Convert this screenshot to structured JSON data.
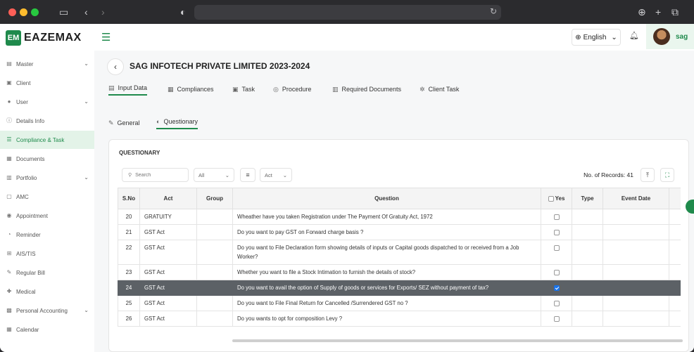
{
  "brand": {
    "name": "EAZEMAX",
    "mark": "EM",
    "accent": "#1f8a4c"
  },
  "header": {
    "language": "English",
    "user": "sag"
  },
  "sidebar": {
    "items": [
      {
        "label": "Master",
        "icon": "database-icon",
        "expandable": true
      },
      {
        "label": "Client",
        "icon": "client-icon",
        "expandable": false
      },
      {
        "label": "User",
        "icon": "user-icon",
        "expandable": true
      },
      {
        "label": "Details Info",
        "icon": "info-icon",
        "expandable": false
      },
      {
        "label": "Compliance & Task",
        "icon": "checklist-icon",
        "expandable": false,
        "active": true
      },
      {
        "label": "Documents",
        "icon": "documents-icon",
        "expandable": false
      },
      {
        "label": "Portfolio",
        "icon": "portfolio-icon",
        "expandable": true
      },
      {
        "label": "AMC",
        "icon": "amc-icon",
        "expandable": false
      },
      {
        "label": "Appointment",
        "icon": "appointment-icon",
        "expandable": false
      },
      {
        "label": "Reminder",
        "icon": "reminder-icon",
        "expandable": false
      },
      {
        "label": "AIS/TIS",
        "icon": "ais-icon",
        "expandable": false
      },
      {
        "label": "Regular Bill",
        "icon": "bill-icon",
        "expandable": false
      },
      {
        "label": "Medical",
        "icon": "medical-icon",
        "expandable": false
      },
      {
        "label": "Personal Accounting",
        "icon": "accounting-icon",
        "expandable": true
      },
      {
        "label": "Calendar",
        "icon": "calendar-icon",
        "expandable": false
      }
    ]
  },
  "page": {
    "title": "SAG INFOTECH PRIVATE LIMITED 2023-2024",
    "tabs": [
      "Input Data",
      "Compliances",
      "Task",
      "Procedure",
      "Required Documents",
      "Client Task"
    ],
    "subtabs": [
      "General",
      "Questionary"
    ]
  },
  "questionary": {
    "title": "QUESTIONARY",
    "search_placeholder": "Search",
    "filter_all": "All",
    "filter_act": "Act",
    "records_label": "No. of Records: 41",
    "columns": [
      "S.No",
      "Act",
      "Group",
      "Question",
      "Yes",
      "Type",
      "Event Date"
    ],
    "rows": [
      {
        "sno": "20",
        "act": "GRATUITY",
        "group": "",
        "question": "Wheather have you taken Registration under The Payment Of Gratuity Act, 1972",
        "yes": false
      },
      {
        "sno": "21",
        "act": "GST Act",
        "group": "",
        "question": "Do you want to pay GST on Forward charge basis ?",
        "yes": false
      },
      {
        "sno": "22",
        "act": "GST Act",
        "group": "",
        "question": "Do you want to File Declaration form showing details of inputs or Capital goods dispatched to or received from a Job Worker?",
        "yes": false
      },
      {
        "sno": "23",
        "act": "GST Act",
        "group": "",
        "question": "Whether you want to file a Stock Intimation to furnish the details of stock?",
        "yes": false
      },
      {
        "sno": "24",
        "act": "GST Act",
        "group": "",
        "question": "Do you want to avail the option of Supply of goods or services for Exports/ SEZ without payment of tax?",
        "yes": true,
        "selected": true
      },
      {
        "sno": "25",
        "act": "GST Act",
        "group": "",
        "question": "Do you want to File Final Return for Cancelled /Surrendered GST no ?",
        "yes": false
      },
      {
        "sno": "26",
        "act": "GST Act",
        "group": "",
        "question": "Do you wants to opt for composition Levy ?",
        "yes": false
      }
    ]
  }
}
